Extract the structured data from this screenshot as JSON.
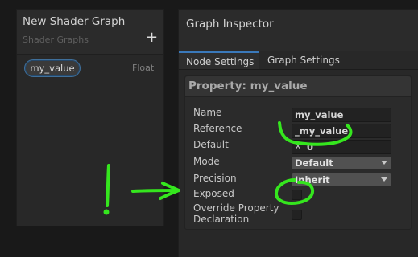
{
  "blackboard": {
    "title": "New Shader Graph",
    "subtitle": "Shader Graphs",
    "add_label": "+",
    "property": {
      "name": "my_value",
      "type": "Float"
    }
  },
  "inspector": {
    "title": "Graph Inspector",
    "tabs": [
      {
        "label": "Node Settings",
        "active": true
      },
      {
        "label": "Graph Settings",
        "active": false
      }
    ],
    "property_title": "Property: my_value",
    "rows": {
      "name": {
        "label": "Name",
        "value": "my_value"
      },
      "reference": {
        "label": "Reference",
        "value": "_my_value"
      },
      "default": {
        "label": "Default",
        "axis": "X",
        "value": "0"
      },
      "mode": {
        "label": "Mode",
        "value": "Default"
      },
      "precision": {
        "label": "Precision",
        "value": "Inherit"
      },
      "exposed": {
        "label": "Exposed",
        "checked": false
      },
      "override": {
        "label_line1": "Override Property",
        "label_line2": "Declaration",
        "checked": false
      }
    }
  },
  "annotation": {
    "color": "#35e61e"
  }
}
